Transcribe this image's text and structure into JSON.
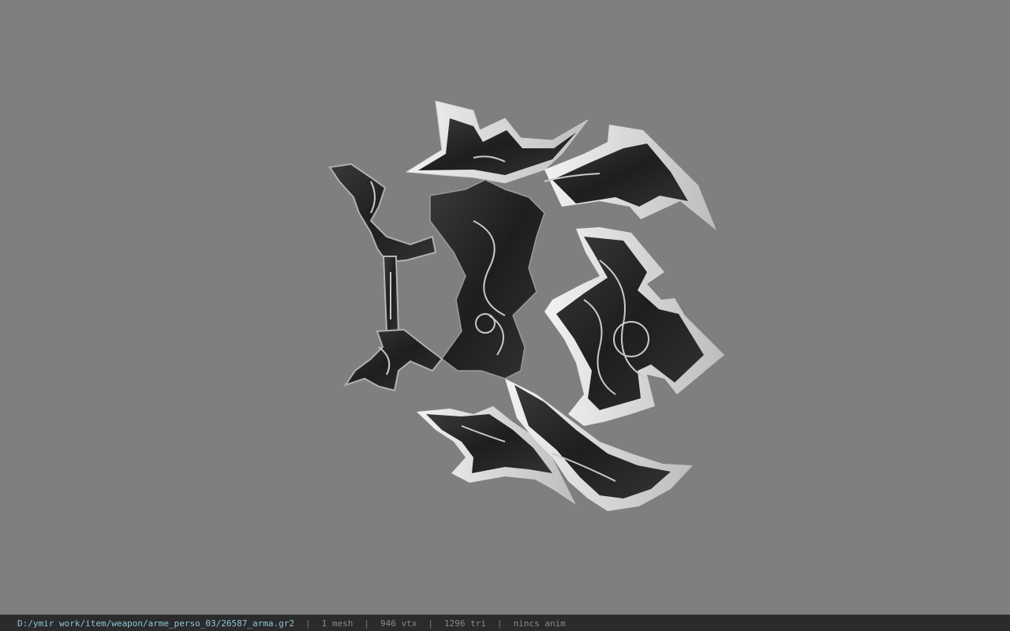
{
  "viewport": {
    "background_color": "#7f7f7f",
    "model": {
      "subject": "ornate dark metal crescent blade weapon (claw/axe) with silver edges and engraved knotwork"
    }
  },
  "status_bar": {
    "path": "D:/ymir work/item/weapon/arme_perso_03/26587_arma.gr2",
    "separator": "|",
    "mesh_count": "1 mesh",
    "vertex_count": "946 vtx",
    "triangle_count": "1296 tri",
    "anim": "nincs anim",
    "colors": {
      "background": "#2b2b2b",
      "path_text": "#8ec6d8",
      "stats_text": "#8a8a8a"
    }
  }
}
